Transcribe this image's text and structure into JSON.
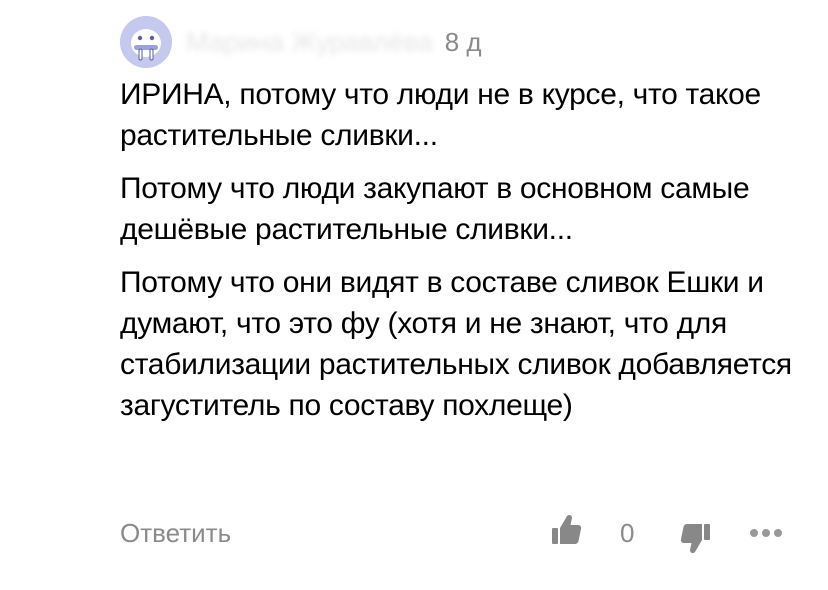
{
  "comment": {
    "author": "Марина Журавлёва",
    "time": "8 д",
    "paragraphs": [
      "ИРИНА, потому что люди не в курсе, что такое растительные сливки...",
      "Потому что люди закупают в основном самые дешёвые растительные сливки...",
      "Потому что они видят в составе сливок Ешки и думают, что это фу (хотя и не знают, что для стабилизации растительных сливок добавляется загуститель по составу похлеще)"
    ],
    "actions": {
      "reply_label": "Ответить",
      "like_icon": "thumb-up-icon",
      "likes_count": "0",
      "dislike_icon": "thumb-down-icon",
      "more_icon": "more-dots-icon"
    }
  },
  "colors": {
    "muted": "#8a8a8a",
    "avatar_bg": "#c6c9ee",
    "icon": "#888888"
  }
}
